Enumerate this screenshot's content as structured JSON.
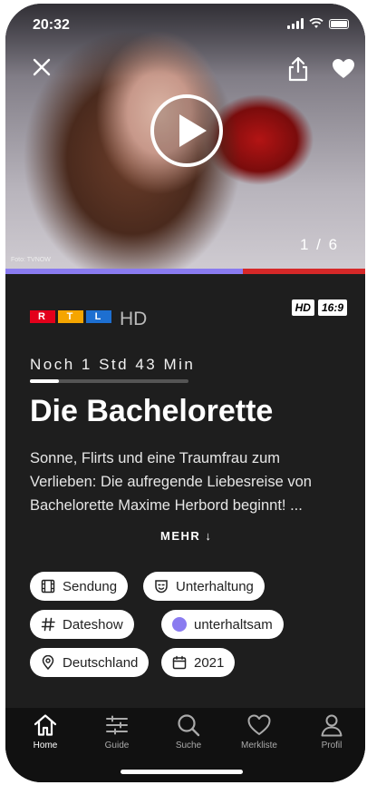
{
  "status": {
    "time": "20:32"
  },
  "hero": {
    "counter": "1 / 6",
    "photo_credit": "Foto: TVNOW",
    "progress_fraction": 0.66
  },
  "channel": {
    "logo": "RTL",
    "quality": "HD",
    "badges": [
      "HD",
      "16:9"
    ]
  },
  "show": {
    "remaining": "Noch 1 Std 43 Min",
    "remaining_fraction": 0.18,
    "title": "Die Bachelorette",
    "description": "Sonne, Flirts und eine Traumfrau zum Verlieben: Die aufregende Liebesreise von Bachelorette Maxime Herbord beginnt! ...",
    "more_label": "MEHR ↓"
  },
  "tags": [
    "Sendung",
    "Unterhaltung",
    "Dateshow",
    "unterhaltsam",
    "Deutschland",
    "2021"
  ],
  "tabs": [
    "Home",
    "Guide",
    "Suche",
    "Merkliste",
    "Profil"
  ],
  "colors": {
    "accent": "#8a7bf0",
    "live_red": "#d62828",
    "rtl_red": "#e3001b",
    "rtl_yellow": "#f5a500",
    "rtl_blue": "#1d6fd1"
  }
}
